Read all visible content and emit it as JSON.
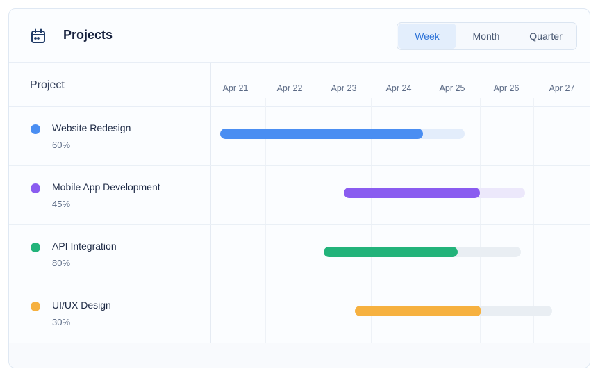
{
  "header": {
    "title": "Projects",
    "icon": "calendar-icon",
    "views": [
      {
        "label": "Week",
        "active": true
      },
      {
        "label": "Month",
        "active": false
      },
      {
        "label": "Quarter",
        "active": false
      }
    ]
  },
  "table": {
    "project_column_label": "Project",
    "days": [
      "Apr 21",
      "Apr 22",
      "Apr 23",
      "Apr 24",
      "Apr 25",
      "Apr 26",
      "Apr 27"
    ]
  },
  "projects": [
    {
      "name": "Website Redesign",
      "progress_label": "60%",
      "progress": 0.6,
      "color": "#4a8ef2",
      "track_color": "#e3edfb",
      "start": "Apr 21",
      "end": "Apr 25"
    },
    {
      "name": "Mobile App Development",
      "progress_label": "45%",
      "progress": 0.45,
      "color": "#8a5cf0",
      "track_color": "#ece8fb",
      "start": "Apr 23",
      "end": "Apr 26"
    },
    {
      "name": "API Integration",
      "progress_label": "80%",
      "progress": 0.8,
      "color": "#22b37a",
      "track_color": "#e9eef3",
      "start": "Apr 23",
      "end": "Apr 26"
    },
    {
      "name": "UI/UX Design",
      "progress_label": "30%",
      "progress": 0.3,
      "color": "#f6b140",
      "track_color": "#e9eef3",
      "start": "Apr 23",
      "end": "Apr 27"
    }
  ]
}
